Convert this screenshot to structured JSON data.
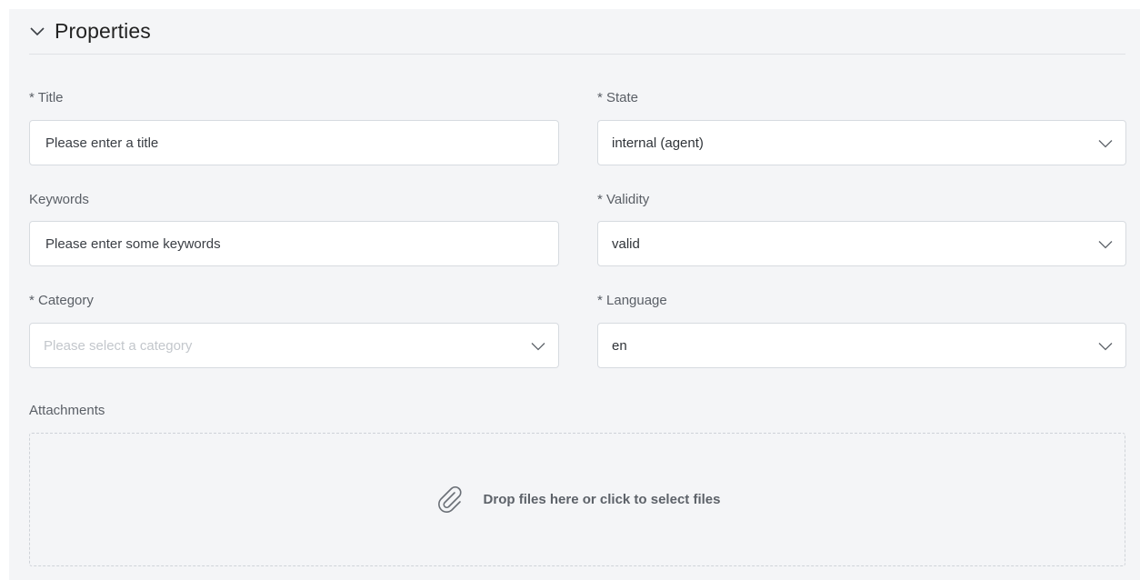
{
  "section": {
    "title": "Properties"
  },
  "fields": {
    "title": {
      "label": "* Title",
      "placeholder": "Please enter a title"
    },
    "state": {
      "label": "* State",
      "value": "internal (agent)"
    },
    "keywords": {
      "label": "Keywords",
      "placeholder": "Please enter some keywords"
    },
    "validity": {
      "label": "* Validity",
      "value": "valid"
    },
    "category": {
      "label": "* Category",
      "placeholder": "Please select a category"
    },
    "language": {
      "label": "* Language",
      "value": "en"
    }
  },
  "attachments": {
    "label": "Attachments",
    "drop_text": "Drop files here or click to select files"
  },
  "icons": {
    "section_toggle": "chevron-down-icon",
    "select_caret": "chevron-down-icon",
    "attachment": "paperclip-icon"
  },
  "colors": {
    "panel_bg": "#f4f5f7",
    "input_border": "#d7dbe0",
    "label_text": "#5a5f66"
  }
}
